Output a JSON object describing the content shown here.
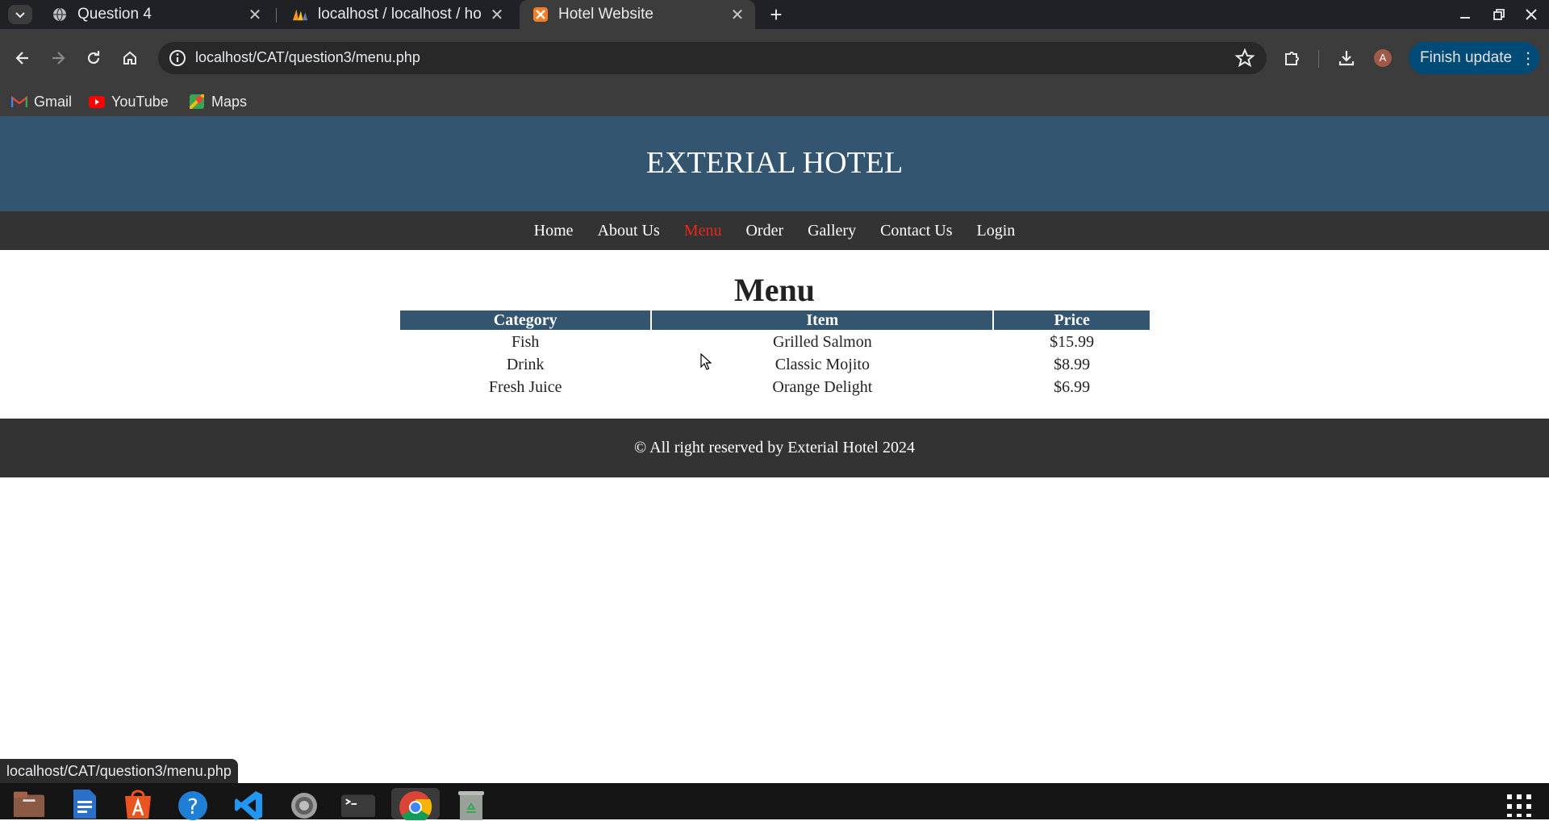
{
  "browser": {
    "tabs": [
      {
        "title": "Question 4",
        "icon": "globe-icon",
        "active": false
      },
      {
        "title": "localhost / localhost / ho",
        "icon": "phpmyadmin-icon",
        "active": false
      },
      {
        "title": "Hotel Website",
        "icon": "xampp-icon",
        "active": true
      }
    ],
    "close_glyph": "✕",
    "new_tab_glyph": "+",
    "address": "localhost/CAT/question3/menu.php",
    "finish_update": "Finish update",
    "profile_initial": "A",
    "bookmarks": [
      {
        "label": "Gmail",
        "icon": "gmail-icon"
      },
      {
        "label": "YouTube",
        "icon": "youtube-icon"
      },
      {
        "label": "Maps",
        "icon": "maps-icon"
      }
    ]
  },
  "site": {
    "title": "EXTERIAL HOTEL",
    "nav": [
      {
        "label": "Home",
        "active": false
      },
      {
        "label": "About Us",
        "active": false
      },
      {
        "label": "Menu",
        "active": true
      },
      {
        "label": "Order",
        "active": false
      },
      {
        "label": "Gallery",
        "active": false
      },
      {
        "label": "Contact Us",
        "active": false
      },
      {
        "label": "Login",
        "active": false
      }
    ],
    "heading": "Menu",
    "table": {
      "headers": [
        "Category",
        "Item",
        "Price"
      ],
      "rows": [
        [
          "Fish",
          "Grilled Salmon",
          "$15.99"
        ],
        [
          "Drink",
          "Classic Mojito",
          "$8.99"
        ],
        [
          "Fresh Juice",
          "Orange Delight",
          "$6.99"
        ]
      ]
    },
    "footer": "© All right reserved by Exterial Hotel 2024"
  },
  "status_url": "localhost/CAT/question3/menu.php",
  "colors": {
    "header_bg": "#34556f",
    "nav_bg": "#333333",
    "active_nav": "#e8291c",
    "footer_bg": "#333333"
  }
}
